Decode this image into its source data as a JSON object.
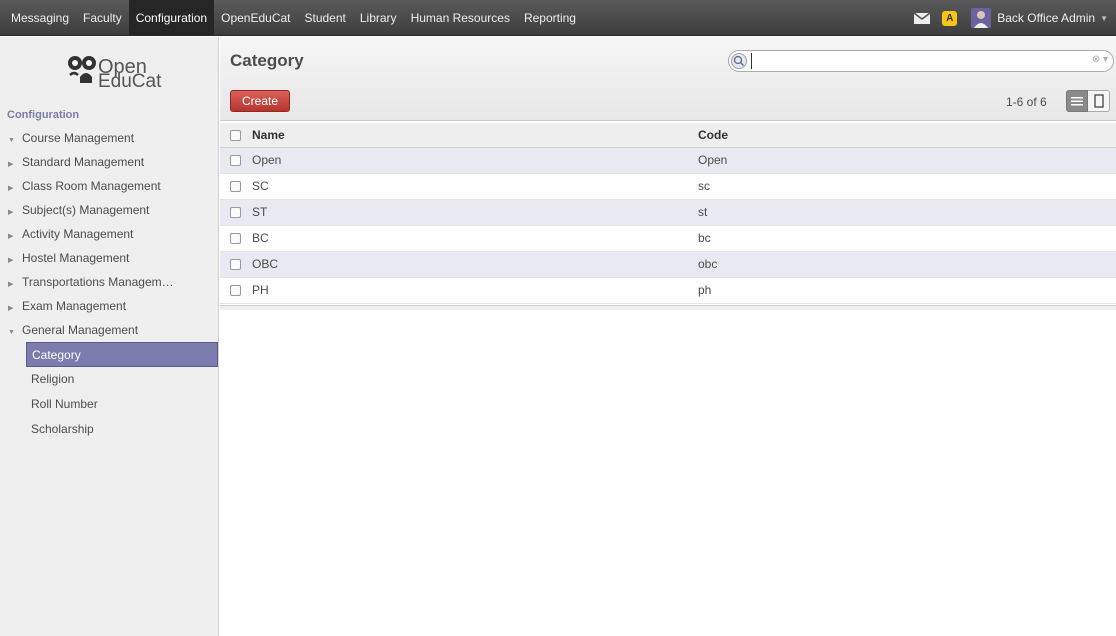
{
  "topbar": {
    "menu": [
      "Messaging",
      "Faculty",
      "Configuration",
      "OpenEduCat",
      "Student",
      "Library",
      "Human Resources",
      "Reporting"
    ],
    "active_menu": "Configuration",
    "user_name": "Back Office Admin",
    "alert_symbol": "A"
  },
  "sidebar": {
    "logo_line1": "Open",
    "logo_line2": "EduCat",
    "section_title": "Configuration",
    "items": [
      {
        "label": "Course Management",
        "expanded": true
      },
      {
        "label": "Standard Management",
        "expanded": false
      },
      {
        "label": "Class Room Management",
        "expanded": false
      },
      {
        "label": "Subject(s) Management",
        "expanded": false
      },
      {
        "label": "Activity Management",
        "expanded": false
      },
      {
        "label": "Hostel Management",
        "expanded": false
      },
      {
        "label": "Transportations Managem…",
        "expanded": false
      },
      {
        "label": "Exam Management",
        "expanded": false
      },
      {
        "label": "General Management",
        "expanded": true
      }
    ],
    "subitems": [
      "Category",
      "Religion",
      "Roll Number",
      "Scholarship"
    ],
    "active_subitem": "Category"
  },
  "main": {
    "title": "Category",
    "create_label": "Create",
    "pager": "1-6 of 6",
    "search_value": ""
  },
  "table": {
    "headers": [
      "Name",
      "Code"
    ],
    "rows": [
      [
        "Open",
        "Open"
      ],
      [
        "SC",
        "sc"
      ],
      [
        "ST",
        "st"
      ],
      [
        "BC",
        "bc"
      ],
      [
        "OBC",
        "obc"
      ],
      [
        "PH",
        "ph"
      ]
    ]
  },
  "colors": {
    "accent": "#7c7bad",
    "create_button": "#c9443d",
    "topbar": "#474747"
  }
}
